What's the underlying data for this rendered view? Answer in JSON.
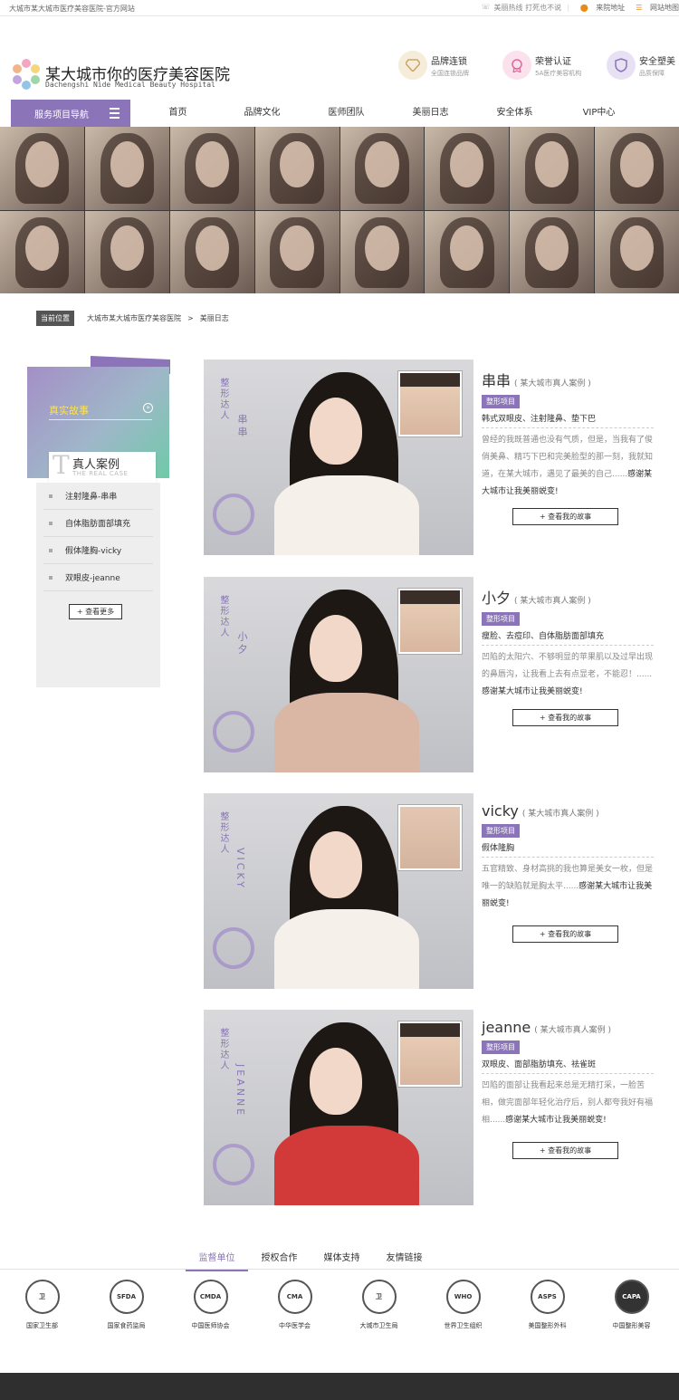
{
  "topbar": {
    "left_text": "大城市某大城市医疗美容医院-官方网站",
    "hotline": "美丽热线 打死也不说",
    "address": "来院地址",
    "sitemap": "网站地图"
  },
  "logo": {
    "cn": "某大城市你的医疗美容医院",
    "en": "Dachengshi Nide Medical Beauty Hospital"
  },
  "badges": [
    {
      "title": "品牌连锁",
      "sub": "全国连锁品牌",
      "color": "#c9a56a"
    },
    {
      "title": "荣誉认证",
      "sub": "5A医疗美容机构",
      "color": "#d96a9a"
    },
    {
      "title": "安全塑美",
      "sub": "品质保障",
      "color": "#8b74b8"
    }
  ],
  "nav": {
    "service_label": "服务项目导航",
    "items": [
      "首页",
      "品牌文化",
      "医师团队",
      "美丽日志",
      "安全体系",
      "VIP中心"
    ]
  },
  "breadcrumb": {
    "current_label": "当前位置",
    "path": [
      "大城市某大城市医疗美容医院",
      "美丽日志"
    ],
    "separator": ">"
  },
  "sidebar": {
    "story": "真实故事",
    "arrow": "»",
    "case_letter": "T",
    "case_cn": "真人案例",
    "case_en": "THE REAL CASE",
    "items": [
      "注射隆鼻-串串",
      "自体脂肪面部填充",
      "假体隆胸-vicky",
      "双眼皮-jeanne"
    ],
    "more": "+ 查看更多"
  },
  "cases": [
    {
      "name": "串串",
      "sub": "( 某大城市真人案例 )",
      "tag": "整形项目",
      "project": "韩式双眼皮、注射隆鼻、垫下巴",
      "desc": "曾经的我既普通也没有气质，但是，当我有了俊俏美鼻、精巧下巴和完美脸型的那一刻，我就知道，在某大城市，遇见了最美的自己......",
      "thanks": "感谢某大城市让我美丽蜕变!",
      "btn": "+ 查看我的故事",
      "vtext": "整形达人",
      "vname": "串串"
    },
    {
      "name": "小夕",
      "sub": "( 某大城市真人案例 )",
      "tag": "整形项目",
      "project": "瘦脸、去痘印、自体脂肪面部填充",
      "desc": "凹陷的太阳穴、不够明显的苹果肌以及过早出现的鼻唇沟，让我看上去有点显老，不能忍！......",
      "thanks": "感谢某大城市让我美丽蜕变!",
      "btn": "+ 查看我的故事",
      "vtext": "整形达人",
      "vname": "小夕"
    },
    {
      "name": "vicky",
      "sub": "( 某大城市真人案例 )",
      "tag": "整形项目",
      "project": "假体隆胸",
      "desc": "五官精致、身材高挑的我也算是美女一枚，但是唯一的缺陷就是胸太平......",
      "thanks": "感谢某大城市让我美丽蜕变!",
      "btn": "+ 查看我的故事",
      "vtext": "整形达人",
      "vname": "VICKY"
    },
    {
      "name": "jeanne",
      "sub": "( 某大城市真人案例 )",
      "tag": "整形项目",
      "project": "双眼皮、面部脂肪填充、祛雀斑",
      "desc": "凹陷的面部让我看起来总是无精打采，一脸苦相，做完面部年轻化治疗后，别人都夸我好有福相......",
      "thanks": "感谢某大城市让我美丽蜕变!",
      "btn": "+ 查看我的故事",
      "vtext": "整形达人",
      "vname": "JEANNE"
    }
  ],
  "footer": {
    "tabs": [
      "监督单位",
      "授权合作",
      "媒体支持",
      "友情链接"
    ],
    "partners": [
      {
        "abbr": "卫",
        "label": "国家卫生部"
      },
      {
        "abbr": "SFDA",
        "label": "国家食药监局"
      },
      {
        "abbr": "CMDA",
        "label": "中国医师协会"
      },
      {
        "abbr": "CMA",
        "label": "中华医学会"
      },
      {
        "abbr": "卫",
        "label": "大城市卫生局"
      },
      {
        "abbr": "WHO",
        "label": "世界卫生组织"
      },
      {
        "abbr": "ASPS",
        "label": "美国整形外科"
      },
      {
        "abbr": "CAPA",
        "label": "中国整形美容"
      }
    ]
  },
  "colors": {
    "accent": "#8b74b8"
  }
}
